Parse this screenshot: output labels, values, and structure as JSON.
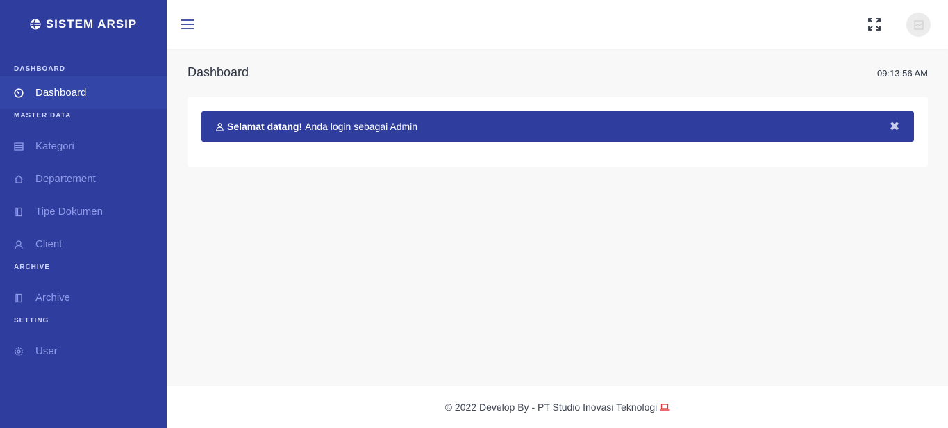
{
  "brand": {
    "title": "SISTEM ARSIP",
    "icon": "globe-icon",
    "color": "#2f3e9e"
  },
  "sidebar": {
    "sections": [
      {
        "label": "DASHBOARD"
      },
      {
        "label": "MASTER DATA"
      },
      {
        "label": "ARCHIVE"
      },
      {
        "label": "SETTING"
      }
    ],
    "items": [
      {
        "label": "Dashboard",
        "icon": "dashboard-icon",
        "active": true
      },
      {
        "label": "Kategori",
        "icon": "list-icon"
      },
      {
        "label": "Departement",
        "icon": "home-icon"
      },
      {
        "label": "Tipe Dokumen",
        "icon": "document-icon"
      },
      {
        "label": "Client",
        "icon": "user-icon"
      },
      {
        "label": "Archive",
        "icon": "document-icon"
      },
      {
        "label": "User",
        "icon": "gear-icon"
      }
    ]
  },
  "topbar": {
    "menu_icon": "hamburger-icon",
    "fullscreen_icon": "expand-icon",
    "avatar_icon": "avatar-icon"
  },
  "main": {
    "title": "Dashboard",
    "clock": "09:13:56 AM",
    "alert": {
      "strong": "Selamat datang!",
      "text": "Anda login sebagai Admin",
      "close": "✖"
    }
  },
  "footer": {
    "text": "© 2022 Develop By - PT Studio Inovasi Teknologi",
    "icon": "laptop-icon",
    "icon_color": "#e53935"
  }
}
